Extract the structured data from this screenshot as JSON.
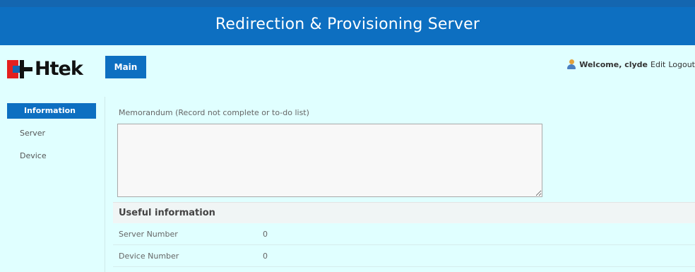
{
  "banner": {
    "title": "Redirection & Provisioning Server"
  },
  "logo": {
    "text": "Htek"
  },
  "nav": {
    "main_tab": "Main"
  },
  "userbar": {
    "welcome": "Welcome, clyde",
    "edit": "Edit",
    "logout": "Logout"
  },
  "sidebar": {
    "items": [
      {
        "label": "Information",
        "active": true
      },
      {
        "label": "Server",
        "active": false
      },
      {
        "label": "Device",
        "active": false
      }
    ]
  },
  "memo": {
    "label": "Memorandum (Record not complete or to-do list)",
    "value": ""
  },
  "useful": {
    "title": "Useful information",
    "rows": [
      {
        "key": "Server Number",
        "value": "0"
      },
      {
        "key": "Device Number",
        "value": "0"
      }
    ]
  },
  "colors": {
    "primary": "#0d6fc1",
    "background": "#e0ffff",
    "logo_red": "#e4201f"
  }
}
